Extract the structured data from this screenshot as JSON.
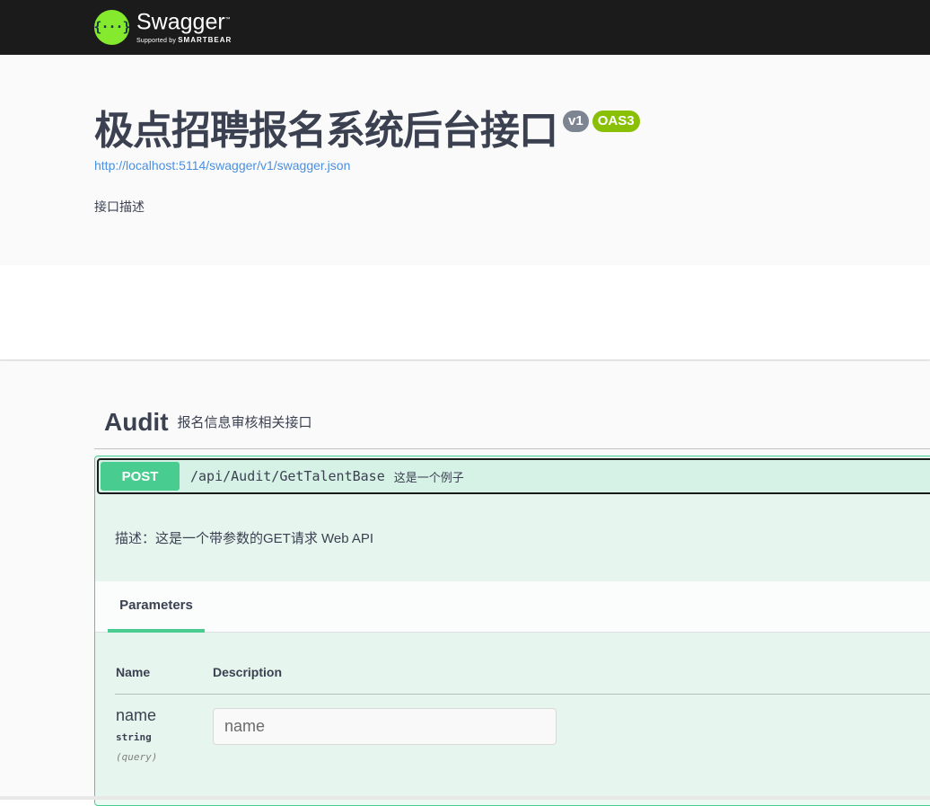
{
  "topbar": {
    "logo_glyph": "{···}",
    "brand": "Swagger",
    "supported_by": "Supported by",
    "smartbear": "SMARTBEAR"
  },
  "info": {
    "title": "极点招聘报名系统后台接口",
    "version_badge": "v1",
    "oas_badge": "OAS3",
    "spec_url": "http://localhost:5114/swagger/v1/swagger.json",
    "description": "接口描述"
  },
  "tag": {
    "name": "Audit",
    "description": "报名信息审核相关接口"
  },
  "operation": {
    "method": "POST",
    "path": "/api/Audit/GetTalentBase",
    "summary": "这是一个例子",
    "description": "描述：这是一个带参数的GET请求 Web API",
    "parameters_tab": "Parameters",
    "columns": {
      "name": "Name",
      "description": "Description"
    },
    "parameters": [
      {
        "name": "name",
        "type": "string",
        "in": "(query)",
        "placeholder": "name"
      }
    ]
  },
  "colors": {
    "topbar": "#1b1b1b",
    "logo": "#85ea2d",
    "post": "#49cc90",
    "version": "#7d8492",
    "oas": "#89bf04",
    "link": "#4990e2"
  }
}
